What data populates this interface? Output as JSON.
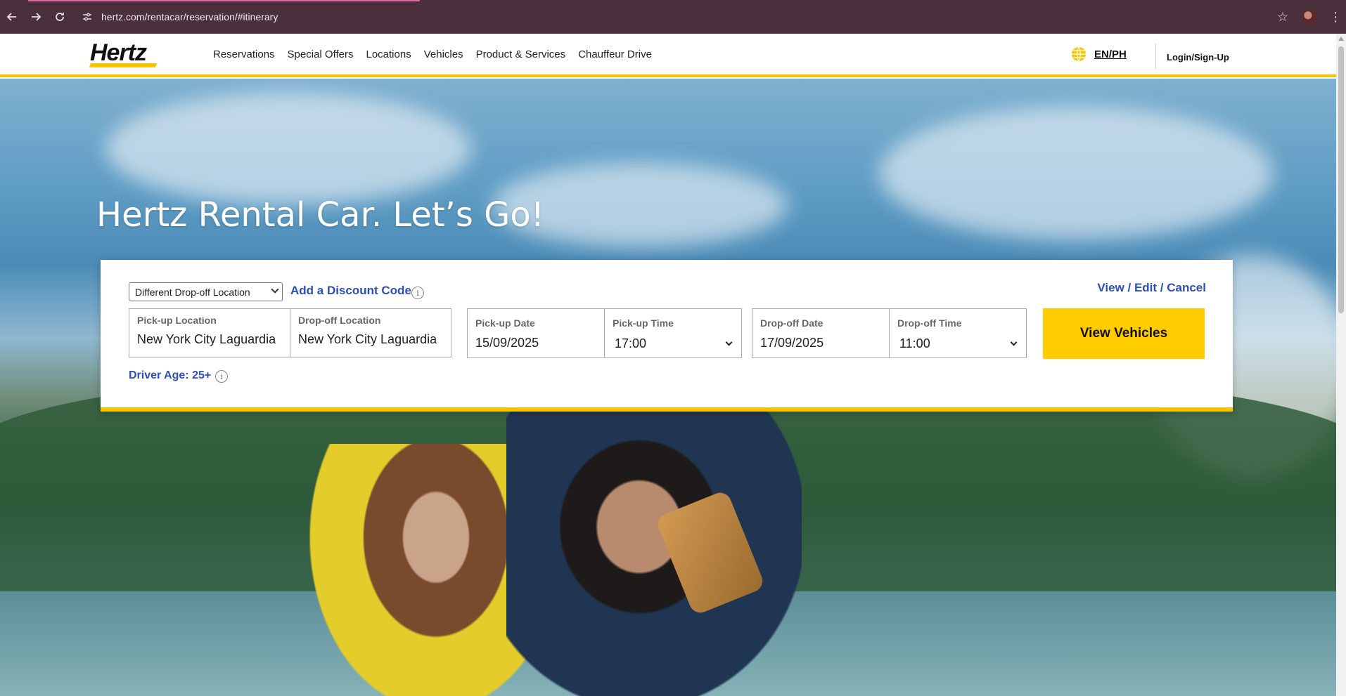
{
  "browser": {
    "url": "hertz.com/rentacar/reservation/#itinerary",
    "back_icon": "arrow-left-icon",
    "forward_icon": "arrow-right-icon",
    "reload_icon": "reload-icon",
    "site_info_icon": "tune-icon",
    "bookmark_icon": "star-icon",
    "menu_icon": "kebab-icon"
  },
  "header": {
    "logo": "Hertz",
    "brand_color": "#f6c500",
    "nav": [
      "Reservations",
      "Special Offers",
      "Locations",
      "Vehicles",
      "Product & Services",
      "Chauffeur Drive"
    ],
    "language": "EN/PH",
    "login": "Login/Sign-Up"
  },
  "hero": {
    "title": "Hertz Rental Car. Let’s Go!"
  },
  "booking": {
    "location_mode": "Different Drop-off Location",
    "discount_link": "Add a Discount Code",
    "info_glyph": "i",
    "view_edit_cancel": "View / Edit / Cancel",
    "pickup_location": {
      "label": "Pick-up Location",
      "value": "New York City Laguardia"
    },
    "dropoff_location": {
      "label": "Drop-off Location",
      "value": "New York City Laguardia"
    },
    "pickup_date": {
      "label": "Pick-up Date",
      "value": "15/09/2025"
    },
    "pickup_time": {
      "label": "Pick-up Time",
      "value": "17:00"
    },
    "dropoff_date": {
      "label": "Drop-off Date",
      "value": "17/09/2025"
    },
    "dropoff_time": {
      "label": "Drop-off Time",
      "value": "11:00"
    },
    "driver_age": "Driver Age: 25+",
    "submit": "View Vehicles",
    "link_color": "#2c4fb3",
    "button_color": "#ffcc00"
  }
}
